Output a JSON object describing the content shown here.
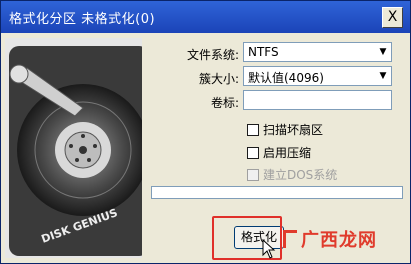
{
  "window": {
    "title": "格式化分区  未格式化(0)",
    "close_glyph": "X"
  },
  "form": {
    "fs_label": "文件系统:",
    "fs_value": "NTFS",
    "cluster_label": "簇大小:",
    "cluster_value": "默认值(4096)",
    "volume_label": "卷标:",
    "volume_value": ""
  },
  "options": {
    "scan_bad": "扫描坏扇区",
    "compress": "启用压缩",
    "dos": "建立DOS系统"
  },
  "progress": {
    "value": 0
  },
  "buttons": {
    "format": "格式化"
  },
  "artwork": {
    "logo_text": "DISK GENIUS"
  },
  "watermark": {
    "text": "广西龙网"
  },
  "colors": {
    "titlebar": "#1b44b8",
    "highlight": "#e0302a",
    "watermark": "#e03b2c"
  }
}
